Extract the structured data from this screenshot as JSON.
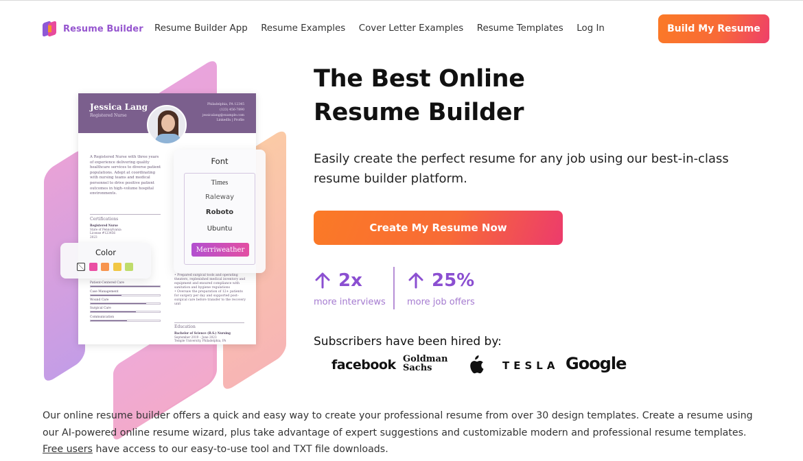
{
  "header": {
    "logo_text": "Resume Builder",
    "nav": [
      "Resume Builder App",
      "Resume Examples",
      "Cover Letter Examples",
      "Resume Templates",
      "Log In"
    ],
    "build_button": "Build My Resume"
  },
  "colors": {
    "brand_purple": "#9656cf",
    "cta_orange": "#fb7a26",
    "cta_pink": "#ec3b6c",
    "stat_purple": "#8b4fd1",
    "resume_header": "#7b5f8d"
  },
  "resume": {
    "name": "Jessica Lang",
    "title": "Registered Nurse",
    "contact": [
      "Philadelphia, PA 12345",
      "(123) 456-7890",
      "jessicalang@example.com",
      "LinkedIn | Profile"
    ],
    "summary": "A Registered Nurse with three years of experience delivering quality healthcare services to diverse patient populations. Adept at coordinating with nursing teams and medical personnel to drive positive patient outcomes in high–volume hospital environments.",
    "certifications_heading": "Certifications",
    "certification": {
      "name": "Registered Nurse",
      "lines": [
        "State of Pennsylvania",
        "License #123456",
        "2023"
      ]
    },
    "skills": [
      {
        "label": "Patient-Centered Care",
        "level": 1.0
      },
      {
        "label": "Case Management",
        "level": 0.45
      },
      {
        "label": "Wound Care",
        "level": 0.8
      },
      {
        "label": "Surgical Care",
        "level": 0.65
      },
      {
        "label": "Communication",
        "level": 0.52
      }
    ],
    "bullets": [
      "Prepared surgical tools and operating theaters, replenished medical inventory and equipment and ensured compliance with sanitation and hygiene regulations",
      "Oversaw the preparation of 12+ patients for surgery per day and supported post–surgical care before transfer to the recovery unit"
    ],
    "education_heading": "Education",
    "education": {
      "degree": "Bachelor of Science (B.S.) Nursing",
      "dates": "September 2019 – June 2023",
      "school": "Temple University, Philadelphia, PA"
    }
  },
  "font_panel": {
    "title": "Font",
    "options": [
      "Times",
      "Raleway",
      "Roboto",
      "Ubuntu"
    ],
    "selected": "Merriweather"
  },
  "color_panel": {
    "title": "Color",
    "swatches": [
      "none",
      "#ea4fa4",
      "#f7944e",
      "#f1c744",
      "#bfdc6b"
    ]
  },
  "hero": {
    "title_line1": "The Best Online",
    "title_line2": "Resume Builder",
    "subtitle": "Easily create the perfect resume for any job using our best-in-class resume builder platform.",
    "cta": "Create My Resume Now",
    "stats": [
      {
        "value": "2x",
        "label": "more interviews",
        "icon": "arrow-up-icon"
      },
      {
        "value": "25%",
        "label": "more job offers",
        "icon": "arrow-up-icon"
      }
    ],
    "hired_by": "Subscribers have been hired by:",
    "brands": [
      "facebook",
      "Goldman Sachs",
      "Apple",
      "TESLA",
      "Google"
    ]
  },
  "bottom": {
    "text_before": "Our online resume builder offers a quick and easy way to create your professional resume from over 30 design templates. Create a resume using our AI-powered online resume wizard, plus take advantage of expert suggestions and customizable modern and professional resume templates. ",
    "link": "Free users",
    "text_after": " have access to our easy-to-use tool and TXT file downloads."
  }
}
